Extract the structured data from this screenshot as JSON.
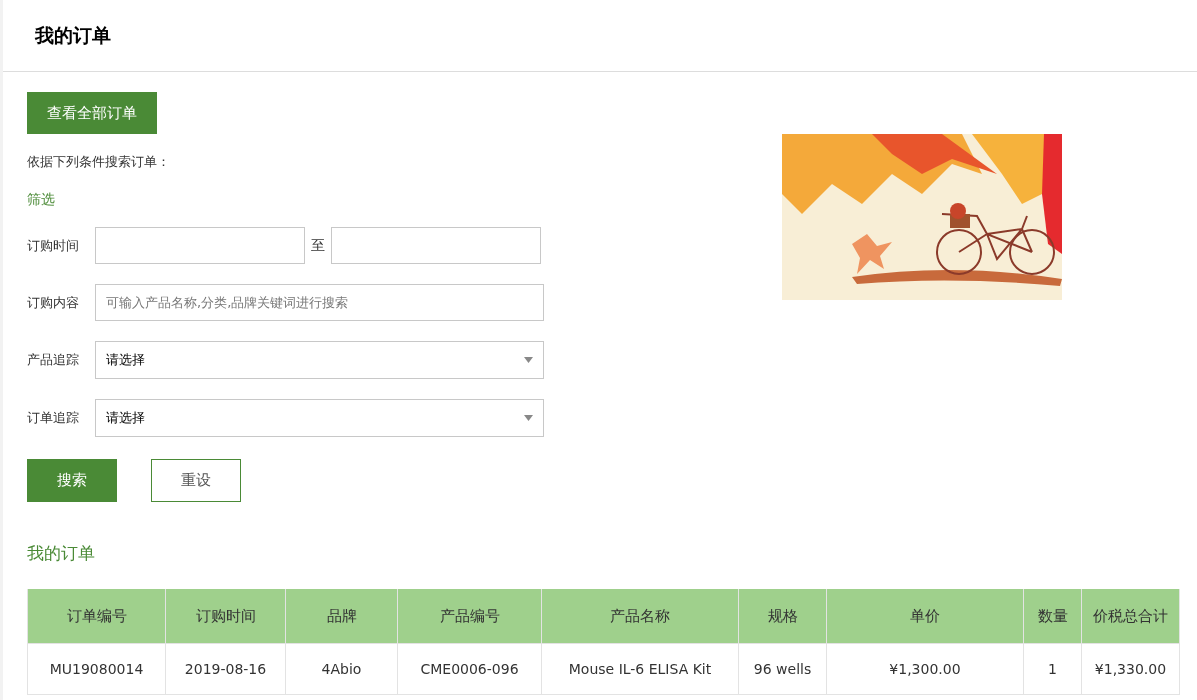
{
  "header": {
    "title": "我的订单"
  },
  "view_all_button": "查看全部订单",
  "search_hint": "依据下列条件搜索订单：",
  "filter_label": "筛选",
  "filters": [
    {
      "kind": "range",
      "label": "订购时间",
      "separator": "至"
    },
    {
      "kind": "text",
      "label": "订购内容",
      "placeholder": "可输入产品名称,分类,品牌关键词进行搜索"
    },
    {
      "kind": "select",
      "label": "产品追踪",
      "value": "请选择"
    },
    {
      "kind": "select",
      "label": "订单追踪",
      "value": "请选择"
    }
  ],
  "buttons": [
    {
      "kind": "primary",
      "label": "搜索"
    },
    {
      "kind": "outline",
      "label": "重设"
    }
  ],
  "orders_title": "我的订单",
  "table": {
    "columns": [
      "订单编号",
      "订购时间",
      "品牌",
      "产品编号",
      "产品名称",
      "规格",
      "单价",
      "数量",
      "价税总合计"
    ],
    "rows": [
      [
        "MU19080014",
        "2019-08-16",
        "4Abio",
        "CME0006-096",
        "Mouse IL-6 ELISA Kit",
        "96 wells",
        "¥1,300.00",
        "1",
        "¥1,330.00"
      ]
    ]
  }
}
